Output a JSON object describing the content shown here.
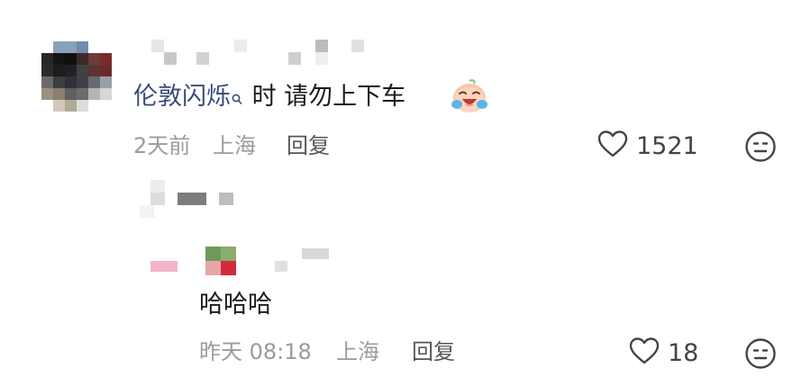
{
  "comment": {
    "username": "(pixelated)",
    "text_link": "伦敦闪烁",
    "text_rest": " 时 请勿上下车",
    "emoji": "crying-laughing-face",
    "date": "2天前",
    "location": "上海",
    "reply_label": "回复",
    "likes": "1521"
  },
  "reply": {
    "parent_username": "(pixelated)",
    "username": "(pixelated)",
    "text": "哈哈哈",
    "date": "昨天 08:18",
    "location": "上海",
    "reply_label": "回复",
    "likes": "18"
  },
  "colors": {
    "text": "#1b1b1b",
    "meta": "#9b9b9b",
    "link": "#3a4a7a",
    "icon": "#444444"
  }
}
